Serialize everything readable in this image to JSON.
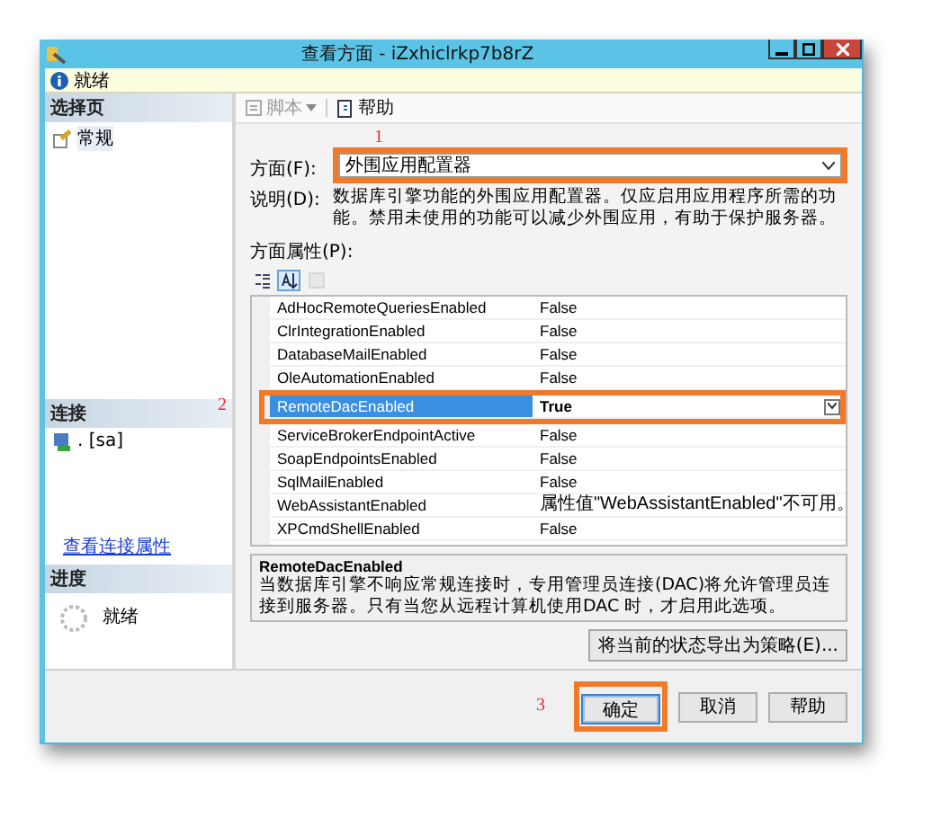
{
  "window": {
    "title": "查看方面 - iZxhiclrkp7b8rZ"
  },
  "info_bar": {
    "text": "就绪"
  },
  "select_page": {
    "header": "选择页",
    "items": [
      {
        "label": "常规",
        "selected": true
      }
    ]
  },
  "connection": {
    "header": "连接",
    "items": [
      ". [sa]"
    ],
    "link": "查看连接属性"
  },
  "progress": {
    "header": "进度",
    "status": "就绪"
  },
  "toolbar": [
    {
      "kind": "dropdown",
      "label": "脚本",
      "disabled": true
    },
    {
      "kind": "button",
      "label": "帮助",
      "disabled": false
    }
  ],
  "facet": {
    "label": "方面(F):",
    "value": "外围应用配置器",
    "annotation": "1"
  },
  "description": {
    "label": "说明(D):",
    "text": "数据库引擎功能的外围应用配置器。仅应启用应用程序所需的功能。禁用未使用的功能可以减少外围应用，有助于保护服务器。"
  },
  "properties": {
    "label": "方面属性(P):",
    "sort_buttons": [
      {
        "kind": "categorized",
        "selected": false,
        "disabled": false
      },
      {
        "kind": "alphabetical",
        "selected": true,
        "disabled": false
      },
      {
        "kind": "pages",
        "selected": false,
        "disabled": true
      }
    ],
    "rows": [
      {
        "name": "AdHocRemoteQueriesEnabled",
        "value": "False",
        "selected": false
      },
      {
        "name": "ClrIntegrationEnabled",
        "value": "False",
        "selected": false
      },
      {
        "name": "DatabaseMailEnabled",
        "value": "False",
        "selected": false
      },
      {
        "name": "OleAutomationEnabled",
        "value": "False",
        "selected": false
      },
      {
        "name": "RemoteDacEnabled",
        "value": "True",
        "selected": true,
        "annotation": "2"
      },
      {
        "name": "ServiceBrokerEndpointActive",
        "value": "False",
        "selected": false
      },
      {
        "name": "SoapEndpointsEnabled",
        "value": "False",
        "selected": false
      },
      {
        "name": "SqlMailEnabled",
        "value": "False",
        "selected": false
      },
      {
        "name": "WebAssistantEnabled",
        "value": "属性值\"WebAssistantEnabled\"不可用。",
        "selected": false
      },
      {
        "name": "XPCmdShellEnabled",
        "value": "False",
        "selected": false
      }
    ]
  },
  "help_panel": {
    "title": "RemoteDacEnabled",
    "text": "当数据库引擎不响应常规连接时，专用管理员连接(DAC)将允许管理员连接到服务器。只有当您从远程计算机使用DAC 时，才启用此选项。"
  },
  "export_button": "将当前的状态导出为策略(E)...",
  "buttons": [
    {
      "label": "确定",
      "focused": true,
      "annotation": "3"
    },
    {
      "label": "取消",
      "focused": false
    },
    {
      "label": "帮助",
      "focused": false
    }
  ]
}
